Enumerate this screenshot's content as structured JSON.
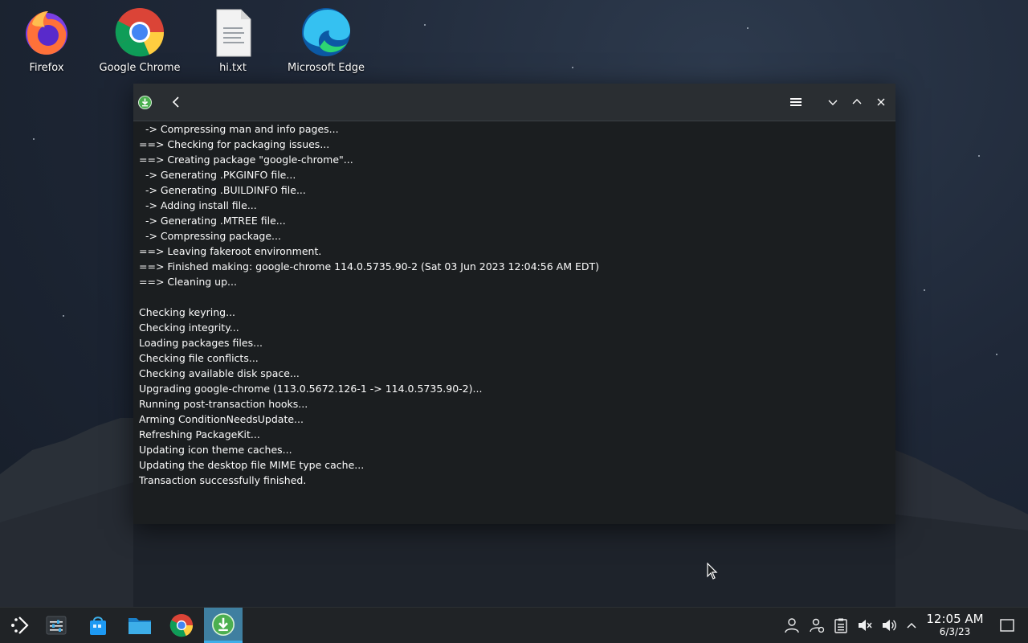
{
  "desktop": {
    "icons": [
      {
        "label": "Firefox",
        "icon": "firefox-icon"
      },
      {
        "label": "Google Chrome",
        "icon": "chrome-icon"
      },
      {
        "label": "hi.txt",
        "icon": "text-file-icon"
      },
      {
        "label": "Microsoft Edge",
        "icon": "edge-icon"
      }
    ]
  },
  "window": {
    "app_icon": "download-install-icon",
    "log": [
      "  -> Compressing man and info pages...",
      "==> Checking for packaging issues...",
      "==> Creating package \"google-chrome\"...",
      "  -> Generating .PKGINFO file...",
      "  -> Generating .BUILDINFO file...",
      "  -> Adding install file...",
      "  -> Generating .MTREE file...",
      "  -> Compressing package...",
      "==> Leaving fakeroot environment.",
      "==> Finished making: google-chrome 114.0.5735.90-2 (Sat 03 Jun 2023 12:04:56 AM EDT)",
      "==> Cleaning up...",
      "",
      "Checking keyring...",
      "Checking integrity...",
      "Loading packages files...",
      "Checking file conflicts...",
      "Checking available disk space...",
      "Upgrading google-chrome (113.0.5672.126-1 -> 114.0.5735.90-2)...",
      "Running post-transaction hooks...",
      "Arming ConditionNeedsUpdate...",
      "Refreshing PackageKit...",
      "Updating icon theme caches...",
      "Updating the desktop file MIME type cache...",
      "Transaction successfully finished."
    ]
  },
  "taskbar": {
    "tasks": [
      "application-launcher-icon",
      "settings-sliders-icon",
      "store-icon",
      "folder-icon",
      "chrome-icon",
      "download-install-icon"
    ],
    "tray": [
      "user-icon",
      "user-switch-icon",
      "clipboard-icon",
      "speaker-muted-icon",
      "speaker-icon",
      "chevron-up-icon"
    ],
    "clock": {
      "time": "12:05 AM",
      "date": "6/3/23"
    }
  },
  "colors": {
    "accent": "#3daee9",
    "window_bg": "#1b1e20",
    "titlebar_bg": "#2a2e32",
    "taskbar_bg": "#202326",
    "install_green": "#4caf50"
  }
}
